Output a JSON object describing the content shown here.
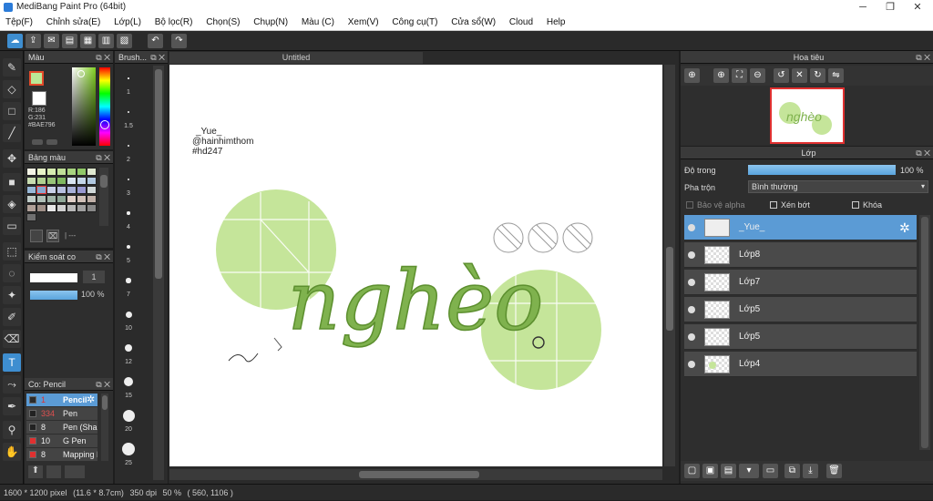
{
  "window": {
    "title": "MediBang Paint Pro (64bit)"
  },
  "menu": [
    "Tệp(F)",
    "Chỉnh sửa(E)",
    "Lớp(L)",
    "Bộ lọc(R)",
    "Chọn(S)",
    "Chụp(N)",
    "Màu (C)",
    "Xem(V)",
    "Công cụ(T)",
    "Cửa sổ(W)",
    "Cloud",
    "Help"
  ],
  "color_panel": {
    "title": "Màu",
    "r": "R:186",
    "g": "G:231",
    "hex": "#BAE796",
    "fg": "#BAE796"
  },
  "swatch_panel": {
    "title": "Bảng màu",
    "sep": "| ---"
  },
  "ctrl_panel": {
    "title": "Kiểm soát co",
    "size": "1",
    "opacity": "100 %"
  },
  "brush_panel": {
    "title": "Co: Pencil",
    "items": [
      {
        "num": "1",
        "name": "Pencil",
        "color": "#2b2b2b"
      },
      {
        "num": "334",
        "name": "Pen",
        "color": "#2b2b2b"
      },
      {
        "num": "8",
        "name": "Pen (Sha",
        "color": "#2b2b2b"
      },
      {
        "num": "10",
        "name": "G Pen",
        "color": "#e03030"
      },
      {
        "num": "8",
        "name": "Mapping P",
        "color": "#e03030"
      }
    ]
  },
  "brush_size_panel": {
    "title": "Brush...",
    "sizes": [
      "1",
      "1.5",
      "2",
      "3",
      "4",
      "5",
      "7",
      "10",
      "12",
      "15",
      "20",
      "25"
    ]
  },
  "canvas": {
    "tab": "Untitled",
    "sig1": "_Yue_",
    "sig2": "@hainhimthom",
    "sig3": "#hd247",
    "word": "nghèo"
  },
  "nav_panel": {
    "title": "Hoa tiêu"
  },
  "layer_panel": {
    "title": "Lớp",
    "opacity_label": "Độ trong",
    "opacity_value": "100 %",
    "blend_label": "Pha trộn",
    "blend_value": "Bình thường",
    "protect_alpha": "Bảo vệ alpha",
    "clip": "Xén bớt",
    "lock": "Khóa",
    "layers": [
      "_Yue_",
      "Lớp8",
      "Lớp7",
      "Lớp5",
      "Lớp5",
      "Lớp4"
    ]
  },
  "status": {
    "size": "1600 * 1200 pixel",
    "cm": "(11.6 * 8.7cm)",
    "dpi": "350 dpi",
    "zoom": "50 %",
    "coords": "( 560, 1106 )"
  }
}
